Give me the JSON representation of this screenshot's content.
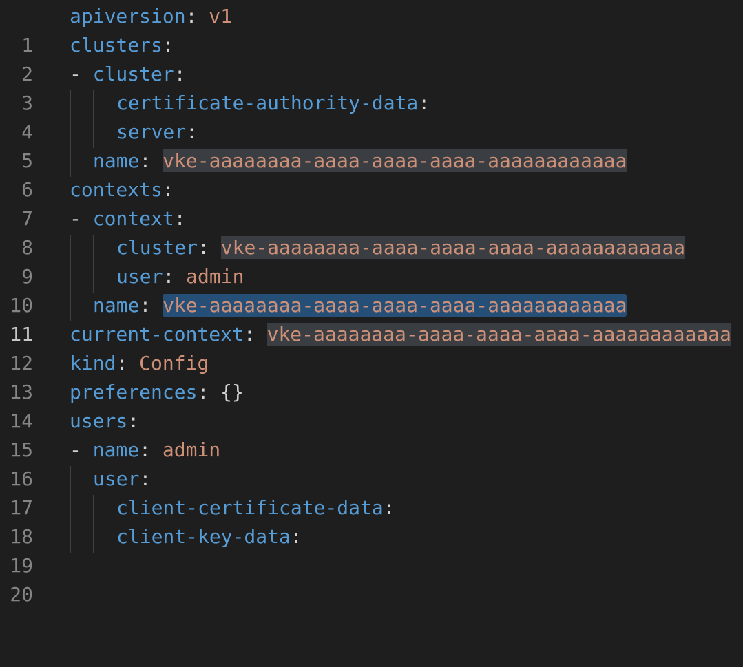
{
  "colors": {
    "background": "#1e1e1e",
    "key": "#569cd6",
    "value": "#ce9178",
    "punctuation": "#d4d4d4",
    "line_number": "#858585",
    "occurrence_highlight": "#3a3d41",
    "selection": "#264f78"
  },
  "editor": {
    "active_line": 11,
    "lines": [
      {
        "num": "1",
        "dash": "",
        "key": "apiversion",
        "colon": ":",
        "value": " v1"
      },
      {
        "num": "2",
        "dash": "",
        "key": "clusters",
        "colon": ":",
        "value": ""
      },
      {
        "num": "3",
        "dash": "- ",
        "key": "cluster",
        "colon": ":",
        "value": ""
      },
      {
        "num": "4",
        "dash": "",
        "key": "certificate-authority-data",
        "colon": ":",
        "value": ""
      },
      {
        "num": "5",
        "dash": "",
        "key": "server",
        "colon": ":",
        "value": ""
      },
      {
        "num": "6",
        "dash": "",
        "key": "name",
        "colon": ":",
        "value": "vke-aaaaaaaa-aaaa-aaaa-aaaa-aaaaaaaaaaaa"
      },
      {
        "num": "7",
        "dash": "",
        "key": "contexts",
        "colon": ":",
        "value": ""
      },
      {
        "num": "8",
        "dash": "- ",
        "key": "context",
        "colon": ":",
        "value": ""
      },
      {
        "num": "9",
        "dash": "",
        "key": "cluster",
        "colon": ":",
        "value": "vke-aaaaaaaa-aaaa-aaaa-aaaa-aaaaaaaaaaaa"
      },
      {
        "num": "10",
        "dash": "",
        "key": "user",
        "colon": ":",
        "value": " admin"
      },
      {
        "num": "11",
        "dash": "",
        "key": "name",
        "colon": ":",
        "value": "vke-aaaaaaaa-aaaa-aaaa-aaaa-aaaaaaaaaaaa"
      },
      {
        "num": "12",
        "dash": "",
        "key": "current-context",
        "colon": ":",
        "value": "vke-aaaaaaaa-aaaa-aaaa-aaaa-aaaaaaaaaaaa"
      },
      {
        "num": "13",
        "dash": "",
        "key": "kind",
        "colon": ":",
        "value": " Config"
      },
      {
        "num": "14",
        "dash": "",
        "key": "preferences",
        "colon": ":",
        "value": " {}"
      },
      {
        "num": "15",
        "dash": "",
        "key": "users",
        "colon": ":",
        "value": ""
      },
      {
        "num": "16",
        "dash": "- ",
        "key": "name",
        "colon": ":",
        "value": " admin"
      },
      {
        "num": "17",
        "dash": "",
        "key": "user",
        "colon": ":",
        "value": ""
      },
      {
        "num": "18",
        "dash": "",
        "key": "client-certificate-data",
        "colon": ":",
        "value": ""
      },
      {
        "num": "19",
        "dash": "",
        "key": "client-key-data",
        "colon": ":",
        "value": ""
      },
      {
        "num": "20",
        "dash": "",
        "key": "",
        "colon": "",
        "value": ""
      }
    ]
  }
}
